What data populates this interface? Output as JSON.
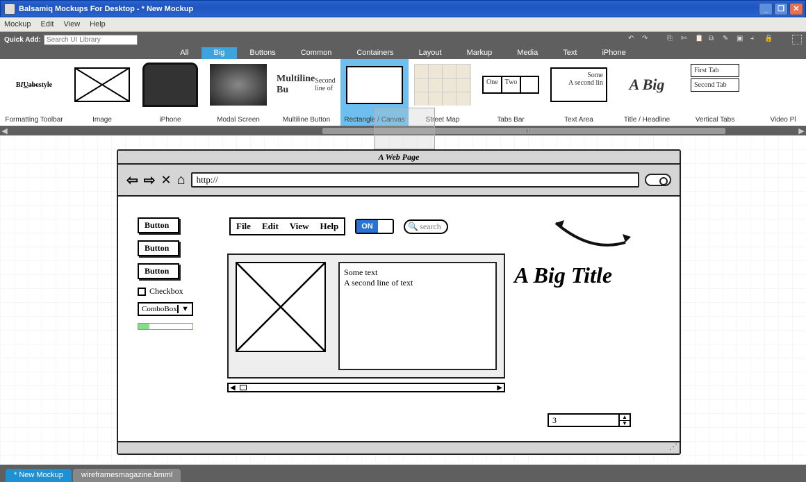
{
  "window": {
    "title": "Balsamiq Mockups For Desktop - * New Mockup"
  },
  "menubar": {
    "items": [
      "Mockup",
      "Edit",
      "View",
      "Help"
    ]
  },
  "toolbar": {
    "quick_add_label": "Quick Add:",
    "quick_add_placeholder": "Search UI Library"
  },
  "categories": {
    "items": [
      "All",
      "Big",
      "Buttons",
      "Common",
      "Containers",
      "Layout",
      "Markup",
      "Media",
      "Text",
      "iPhone"
    ],
    "active": "Big"
  },
  "library": {
    "items": [
      {
        "label": "Formatting Toolbar"
      },
      {
        "label": "Image"
      },
      {
        "label": "iPhone"
      },
      {
        "label": "Modal Screen"
      },
      {
        "label": "Multiline Button",
        "line1": "Multiline Bu",
        "line2": "Second line of"
      },
      {
        "label": "Rectangle / Canvas",
        "selected": true
      },
      {
        "label": "Street Map"
      },
      {
        "label": "Tabs Bar",
        "tab1": "One",
        "tab2": "Two"
      },
      {
        "label": "Text Area",
        "line1": "Some",
        "line2": "A second lin"
      },
      {
        "label": "Title / Headline",
        "text": "A Big"
      },
      {
        "label": "Vertical Tabs",
        "tab1": "First Tab",
        "tab2": "Second Tab"
      },
      {
        "label": "Video Pl"
      }
    ]
  },
  "mockup": {
    "browser_title": "A Web Page",
    "url": "http://",
    "side_buttons": [
      "Button",
      "Button",
      "Button"
    ],
    "checkbox_label": "Checkbox",
    "combo_label": "ComboBox",
    "menu_items": [
      "File",
      "Edit",
      "View",
      "Help"
    ],
    "toggle_on": "ON",
    "search_placeholder": "search",
    "big_title": "A Big Title",
    "text_line1": "Some text",
    "text_line2": "A second line of text",
    "spinner_value": "3"
  },
  "doc_tabs": {
    "items": [
      "* New Mockup",
      "wireframesmagazine.bmml"
    ],
    "active": "* New Mockup"
  }
}
